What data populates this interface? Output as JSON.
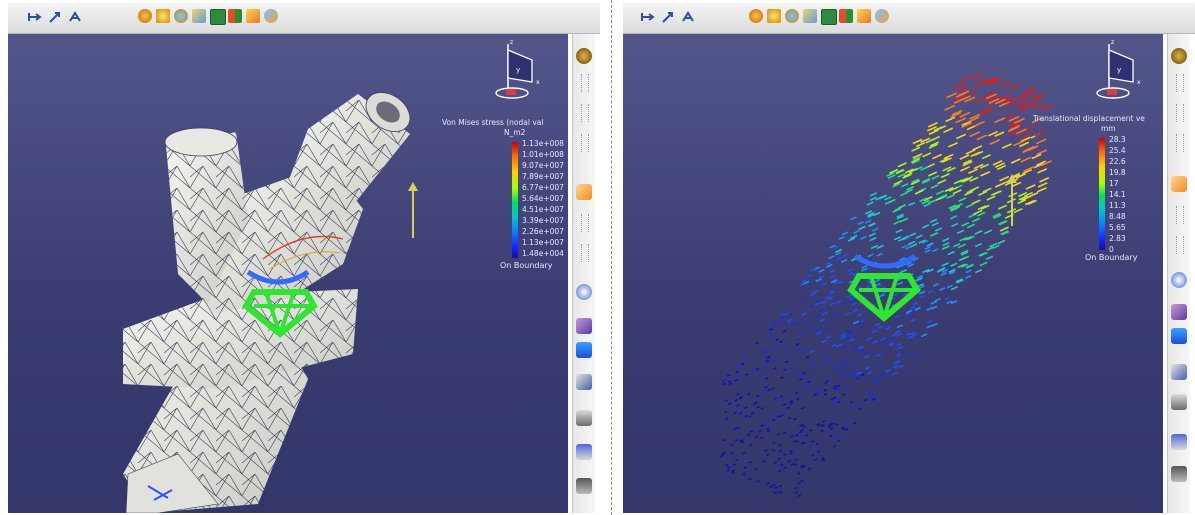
{
  "left_view": {
    "legend": {
      "title": "Von Mises stress (nodal val",
      "unit": "N_m2",
      "values": [
        "1.13e+008",
        "1.01e+008",
        "9.07e+007",
        "7.89e+007",
        "6.77e+007",
        "5.64e+007",
        "4.51e+007",
        "3.39e+007",
        "2.26e+007",
        "1.13e+007",
        "1.48e+004"
      ],
      "footer": "On Boundary"
    },
    "compass": {
      "x_label": "x",
      "y_label": "y",
      "z_label": "z"
    }
  },
  "right_view": {
    "legend": {
      "title": "Translational displacement ve",
      "unit": "mm",
      "values": [
        "28.3",
        "25.4",
        "22.6",
        "19.8",
        "17",
        "14.1",
        "11.3",
        "8.48",
        "5.65",
        "2.83",
        "0"
      ],
      "footer": "On Boundary"
    },
    "compass": {
      "x_label": "x",
      "y_label": "y",
      "z_label": "z"
    }
  },
  "colors": {
    "viewport_bg": "#45477d",
    "clamp_green": "#2ee62e",
    "constraint_blue": "#2f6bff",
    "mesh_surface": "#eeeee9"
  },
  "icons": {
    "top_toolbar": [
      "select-arrow-icon",
      "snap-icon",
      "fly-icon",
      "fit-all-icon",
      "pan-icon",
      "rotate-icon",
      "zoom-icon",
      "normal-view-icon",
      "multi-view-icon",
      "shading-icon",
      "hide-show-icon"
    ],
    "side_toolbar": [
      "catalog-icon",
      "select-icon",
      "zoom-in-icon",
      "zoom-out-icon",
      "view-mode-icon",
      "rotate-view-icon",
      "analysis-icon",
      "measure-icon",
      "clamp-icon"
    ]
  }
}
